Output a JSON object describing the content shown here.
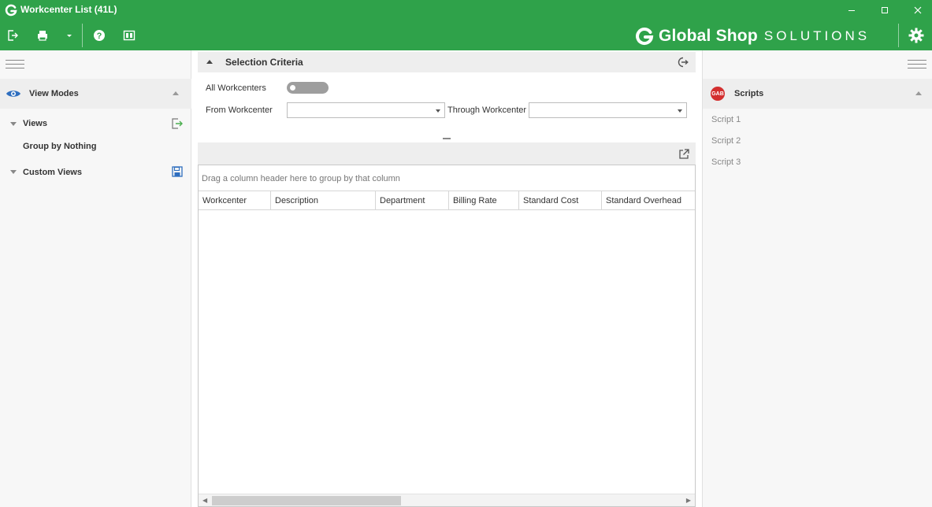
{
  "window": {
    "title": "Workcenter List (41L)",
    "minimize_icon": "minimize-icon",
    "maximize_icon": "maximize-icon",
    "close_icon": "close-icon"
  },
  "toolbar": {
    "items": [
      "exit-icon",
      "print-icon",
      "dropdown-caret-icon",
      "help-icon",
      "layout-toggle-icon"
    ]
  },
  "brand": {
    "bold": "Global Shop",
    "light": "SOLUTIONS"
  },
  "colors": {
    "accent": "#2fa24a",
    "panel_bg": "#f7f7f7",
    "section_bg": "#eeeeee",
    "toggle_off": "#9e9e9e",
    "eye_icon": "#2e6ebf",
    "scripts_icon": "#d32f2f",
    "save_icon": "#2e6ebf",
    "export_icon": "#4caf50"
  },
  "left_panel": {
    "section_title": "View Modes",
    "views_label": "Views",
    "group_by_label": "Group by Nothing",
    "custom_views_label": "Custom Views"
  },
  "criteria": {
    "title": "Selection Criteria",
    "all_workcenters_label": "All Workcenters",
    "all_workcenters_on": false,
    "from_label": "From Workcenter",
    "from_value": "",
    "through_label": "Through Workcenter",
    "through_value": ""
  },
  "grid": {
    "group_hint": "Drag a column header here to group by that column",
    "columns": [
      "Workcenter",
      "Description",
      "Department",
      "Billing Rate",
      "Standard Cost",
      "Standard Overhead"
    ],
    "rows": []
  },
  "right_panel": {
    "section_title": "Scripts",
    "scripts_icon_text": "GAB",
    "items": [
      "Script 1",
      "Script 2",
      "Script 3"
    ]
  }
}
